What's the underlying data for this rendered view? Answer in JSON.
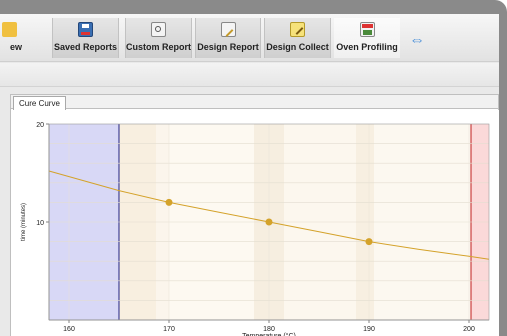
{
  "toolbar": {
    "items": [
      {
        "label": "ew",
        "icon": "view-icon"
      },
      {
        "label": "Saved Reports",
        "icon": "save-icon"
      },
      {
        "label": "Custom Report",
        "icon": "report-icon"
      },
      {
        "label": "Design Report",
        "icon": "design-report-icon"
      },
      {
        "label": "Design Collect",
        "icon": "design-collect-icon"
      },
      {
        "label": "Oven Profiling",
        "icon": "oven-icon"
      }
    ],
    "swap_icon": "swap-arrows-icon"
  },
  "tabs": [
    {
      "label": "Cure Curve"
    }
  ],
  "colors": {
    "curve": "#d4a22a",
    "blue_zone": "#d8d8f6",
    "blue_line": "#202080",
    "red_zone": "#fbd9d9",
    "red_line": "#c02020"
  },
  "chart_data": {
    "type": "line",
    "title": "",
    "xlabel": "Temperature (°C)",
    "ylabel": "time (minutes)",
    "xlim": [
      158,
      202
    ],
    "ylim": [
      0,
      20
    ],
    "x_ticks": [
      160,
      170,
      180,
      190,
      200
    ],
    "y_ticks": [
      10,
      20
    ],
    "grid": true,
    "series": [
      {
        "x": [
          158,
          165,
          170,
          175,
          180,
          185,
          190,
          195,
          200,
          202
        ],
        "values": [
          15.2,
          13.2,
          12.0,
          11.0,
          10.0,
          9.0,
          8.0,
          7.2,
          6.5,
          6.2
        ]
      }
    ],
    "points": [
      {
        "x": 170,
        "y": 12.0
      },
      {
        "x": 180,
        "y": 10.0
      },
      {
        "x": 190,
        "y": 8.0
      }
    ],
    "blue_zone": [
      158,
      165
    ],
    "red_zone": [
      200.2,
      202
    ],
    "bands": [
      {
        "from": 165,
        "to": 168.7
      },
      {
        "from": 168.7,
        "to": 170
      },
      {
        "from": 170,
        "to": 178.5
      },
      {
        "from": 178.5,
        "to": 181.5
      },
      {
        "from": 181.5,
        "to": 188.7
      },
      {
        "from": 188.7,
        "to": 190.5
      },
      {
        "from": 190.5,
        "to": 200.2
      }
    ]
  }
}
